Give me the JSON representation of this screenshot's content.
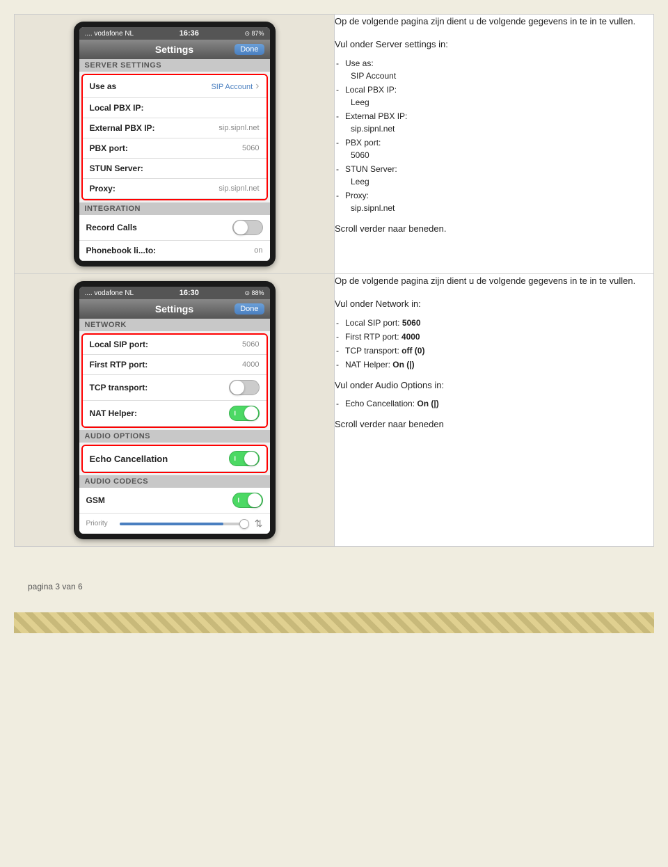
{
  "page": {
    "footer": "pagina 3 van 6"
  },
  "top_section": {
    "left": {
      "iphone": {
        "carrier": ".... vodafone NL",
        "time": "16:36",
        "battery": "87%",
        "title": "Settings",
        "done_button": "Done",
        "server_settings_header": "Server settings",
        "rows": [
          {
            "label": "Use as",
            "value": "SIP Account",
            "type": "arrow"
          },
          {
            "label": "Local PBX IP:",
            "value": "",
            "type": "empty"
          },
          {
            "label": "External PBX IP:",
            "value": "sip.sipnl.net",
            "type": "value"
          },
          {
            "label": "PBX port:",
            "value": "5060",
            "type": "value"
          },
          {
            "label": "STUN Server:",
            "value": "",
            "type": "empty"
          },
          {
            "label": "Proxy:",
            "value": "sip.sipnl.net",
            "type": "value"
          }
        ],
        "integration_header": "Integration",
        "integration_rows": [
          {
            "label": "Record Calls",
            "type": "toggle_off"
          },
          {
            "label": "Phonebook li...to:",
            "value": "on",
            "type": "value_partial"
          }
        ]
      }
    },
    "right": {
      "intro": "Op de volgende pagina zijn dient u de volgende gegevens in te in te vullen.",
      "section_label": "Vul onder Server settings in:",
      "items": [
        {
          "key": "Use as:",
          "value": "SIP Account"
        },
        {
          "key": "Local PBX IP:",
          "value": "Leeg"
        },
        {
          "key": "External PBX IP:",
          "value": "sip.sipnl.net"
        },
        {
          "key": "PBX port:",
          "value": "5060"
        },
        {
          "key": "STUN Server:",
          "value": "Leeg"
        },
        {
          "key": "Proxy:",
          "value": "sip.sipnl.net"
        }
      ],
      "scroll_text": "Scroll verder naar beneden."
    }
  },
  "bottom_section": {
    "left": {
      "iphone": {
        "carrier": ".... vodafone NL",
        "time": "16:30",
        "battery": "88%",
        "title": "Settings",
        "done_button": "Done",
        "network_header": "Network",
        "network_rows": [
          {
            "label": "Local SIP port:",
            "value": "5060",
            "type": "value"
          },
          {
            "label": "First RTP port:",
            "value": "4000",
            "type": "value"
          },
          {
            "label": "TCP transport:",
            "type": "toggle_off"
          },
          {
            "label": "NAT Helper:",
            "type": "toggle_on"
          }
        ],
        "audio_options_header": "Audio Options",
        "audio_rows": [
          {
            "label": "Echo Cancellation",
            "type": "toggle_on",
            "highlighted": true
          }
        ],
        "audio_codecs_header": "Audio Codecs",
        "codec_rows": [
          {
            "label": "GSM",
            "type": "toggle_on"
          }
        ],
        "priority_label": "Priority"
      }
    },
    "right": {
      "intro": "Op de volgende pagina zijn dient u de volgende gegevens in te in te vullen.",
      "section_label_network": "Vul onder Network in:",
      "network_items": [
        {
          "key": "Local SIP port:",
          "value": "5060"
        },
        {
          "key": "First RTP port:",
          "value": "4000"
        },
        {
          "key": "TCP transport:",
          "value": "off (0)"
        },
        {
          "key": "NAT Helper:",
          "value": "On (|)"
        }
      ],
      "section_label_audio": "Vul onder Audio Options in:",
      "audio_items": [
        {
          "key": "Echo Cancellation:",
          "value": "On (|)"
        }
      ],
      "scroll_text": "Scroll verder naar beneden"
    }
  }
}
